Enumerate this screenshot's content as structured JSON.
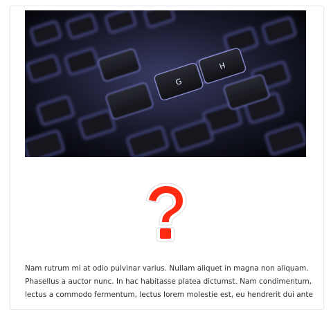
{
  "hero_image": {
    "icon": "keyboard-photo",
    "key_labels": [
      "G",
      "H"
    ]
  },
  "question_icon": {
    "icon": "red-question-mark-icon",
    "glyph": "?",
    "color": "#ff2a12"
  },
  "article": {
    "lines": [
      "Nam rutrum mi at odio pulvinar varius. Nullam aliquet in magna non aliquam.",
      "Phasellus a auctor nunc. In hac habitasse platea dictumst. Nam condimentum,",
      "lectus a commodo fermentum, lectus lorem molestie est, eu hendrerit dui ante"
    ]
  }
}
